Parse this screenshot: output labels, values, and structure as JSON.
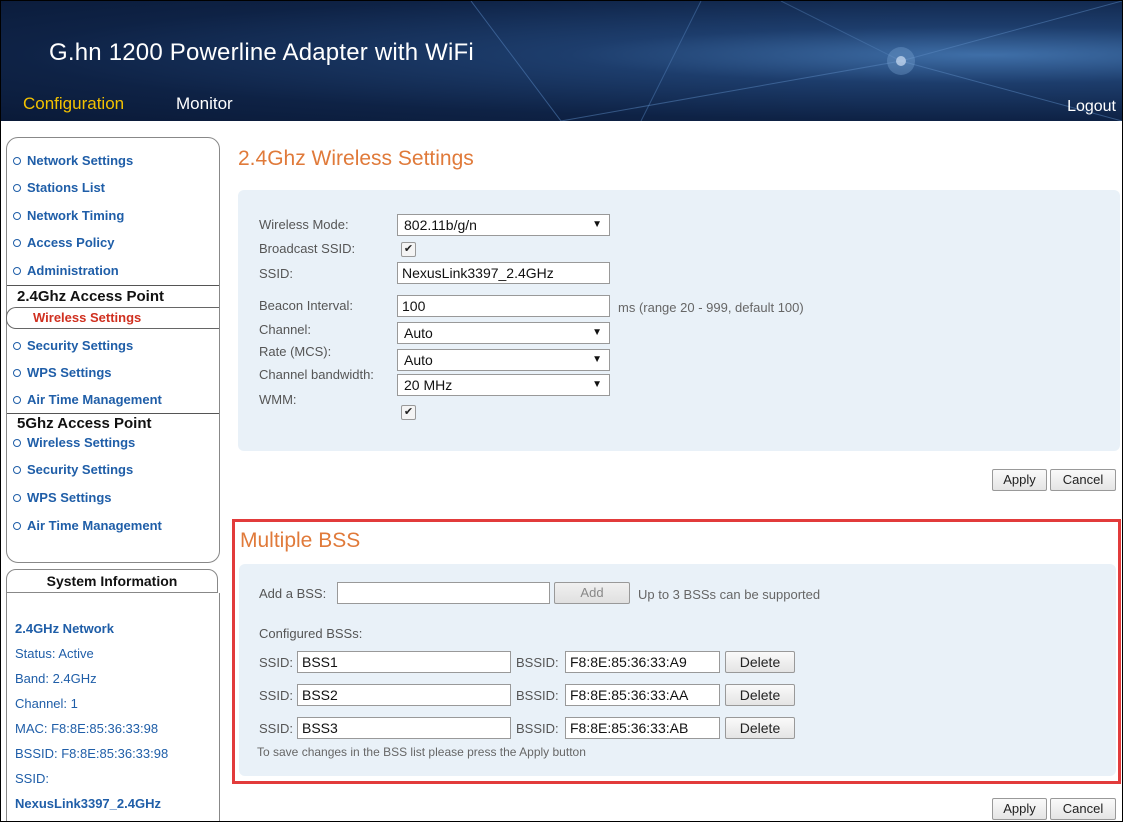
{
  "header": {
    "title": "G.hn 1200 Powerline Adapter with WiFi",
    "nav_configuration": "Configuration",
    "nav_monitor": "Monitor",
    "logout": "Logout"
  },
  "sidebar": {
    "items_top": [
      "Network Settings",
      "Stations List",
      "Network Timing",
      "Access Policy",
      "Administration"
    ],
    "heading_24": "2.4Ghz Access Point",
    "active_item": "Wireless Settings",
    "items_24": [
      "Security Settings",
      "WPS Settings",
      "Air Time Management"
    ],
    "heading_5": "5Ghz Access Point",
    "items_5": [
      "Wireless Settings",
      "Security Settings",
      "WPS Settings",
      "Air Time Management"
    ]
  },
  "system_info": {
    "title": "System Information",
    "lines": [
      "2.4GHz Network",
      "Status: Active",
      "Band: 2.4GHz",
      "Channel: 1",
      "MAC: F8:8E:85:36:33:98",
      "BSSID: F8:8E:85:36:33:98",
      "SSID:",
      "NexusLink3397_2.4GHz"
    ]
  },
  "wireless": {
    "title": "2.4Ghz Wireless Settings",
    "labels": {
      "mode": "Wireless Mode:",
      "broadcast": "Broadcast SSID:",
      "ssid": "SSID:",
      "beacon": "Beacon Interval:",
      "channel": "Channel:",
      "rate": "Rate (MCS):",
      "bandwidth": "Channel bandwidth:",
      "wmm": "WMM:"
    },
    "values": {
      "mode": "802.11b/g/n",
      "broadcast_checked": true,
      "ssid": "NexusLink3397_2.4GHz",
      "beacon": "100",
      "beacon_hint": "ms (range 20 - 999, default 100)",
      "channel": "Auto",
      "rate": "Auto",
      "bandwidth": "20 MHz",
      "wmm_checked": true
    },
    "apply": "Apply",
    "cancel": "Cancel"
  },
  "bss": {
    "title": "Multiple BSS",
    "add_label": "Add a BSS:",
    "add_value": "",
    "add_button": "Add",
    "add_hint": "Up to 3 BSSs can be supported",
    "configured_label": "Configured BSSs:",
    "ssid_label": "SSID:",
    "bssid_label": "BSSID:",
    "delete_label": "Delete",
    "rows": [
      {
        "ssid": "BSS1",
        "bssid": "F8:8E:85:36:33:A9"
      },
      {
        "ssid": "BSS2",
        "bssid": "F8:8E:85:36:33:AA"
      },
      {
        "ssid": "BSS3",
        "bssid": "F8:8E:85:36:33:AB"
      }
    ],
    "note": "To save changes in the BSS list please press the Apply button",
    "apply": "Apply",
    "cancel": "Cancel"
  }
}
